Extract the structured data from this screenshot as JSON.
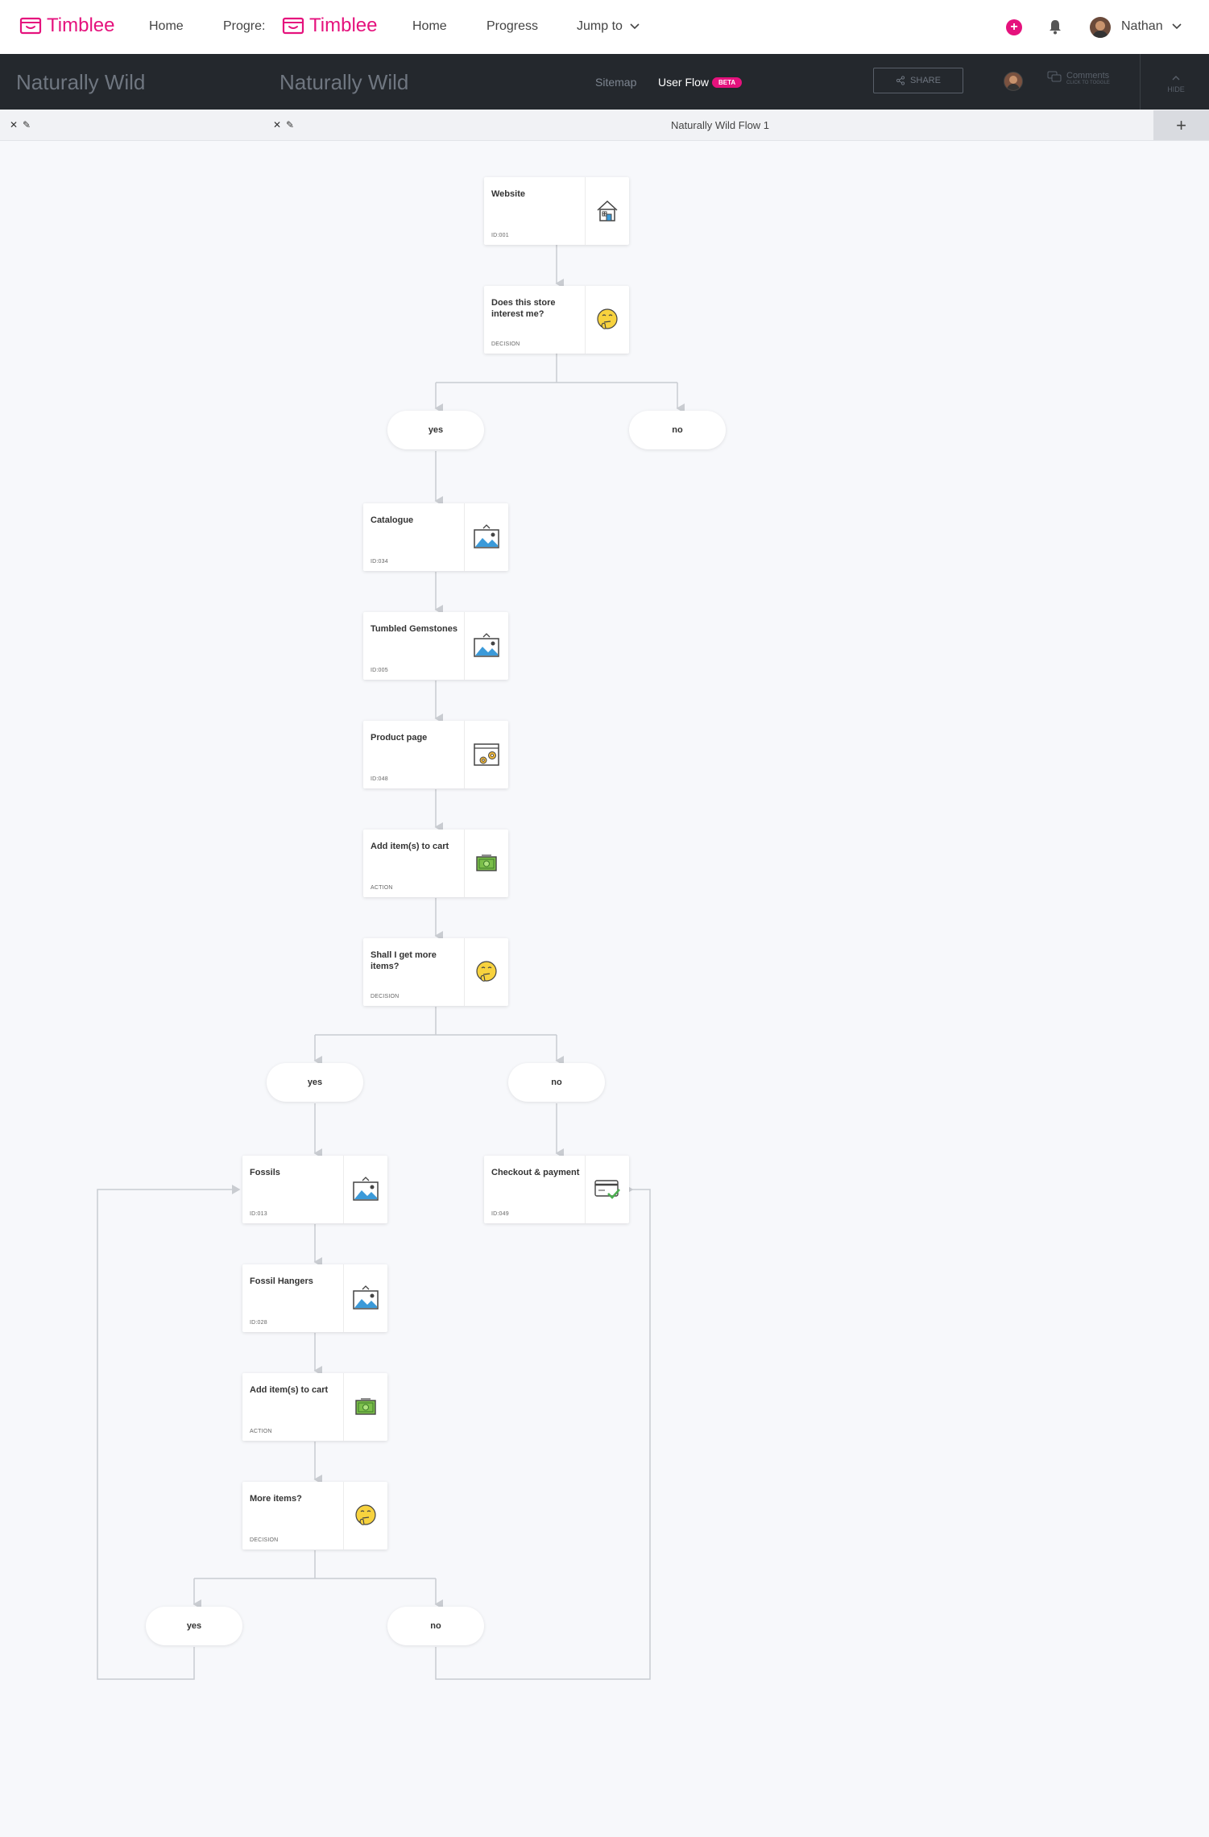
{
  "topnav": {
    "logo_text": "Timblee",
    "links": [
      "Home",
      "Progress"
    ],
    "ghost_links": [
      "Home",
      "Progre:"
    ],
    "jump_to": "Jump to",
    "user_name": "Nathan"
  },
  "project": {
    "name": "Naturally Wild",
    "tabs": [
      "Sitemap",
      "User Flow"
    ],
    "beta_badge": "BETA",
    "share_label": "SHARE",
    "comments_label": "Comments",
    "comments_sub": "CLICK TO TOGGLE",
    "hide_label": "HIDE"
  },
  "flow": {
    "title": "Naturally Wild Flow 1",
    "nodes": [
      {
        "title": "Website",
        "sub": "ID:001",
        "icon": "home-icon"
      },
      {
        "title": "Does this store interest me?",
        "sub": "DECISION",
        "icon": "thinking-face-icon"
      },
      {
        "title": "Catalogue",
        "sub": "ID:034",
        "icon": "image-icon"
      },
      {
        "title": "Tumbled Gemstones",
        "sub": "ID:005",
        "icon": "image-icon"
      },
      {
        "title": "Product page",
        "sub": "ID:048",
        "icon": "browser-settings-icon"
      },
      {
        "title": "Add item(s) to cart",
        "sub": "ACTION",
        "icon": "cash-icon"
      },
      {
        "title": "Shall I get more items?",
        "sub": "DECISION",
        "icon": "thinking-face-icon"
      },
      {
        "title": "Fossils",
        "sub": "ID:013",
        "icon": "image-icon"
      },
      {
        "title": "Checkout & payment",
        "sub": "ID:049",
        "icon": "card-check-icon"
      },
      {
        "title": "Fossil Hangers",
        "sub": "ID:028",
        "icon": "image-icon"
      },
      {
        "title": "Add item(s) to cart",
        "sub": "ACTION",
        "icon": "cash-icon"
      },
      {
        "title": "More items?",
        "sub": "DECISION",
        "icon": "thinking-face-icon"
      }
    ],
    "answers": [
      "yes",
      "no",
      "yes",
      "no",
      "yes",
      "no"
    ]
  },
  "colors": {
    "brand": "#e5127d",
    "header_bg": "#24282d",
    "canvas_bg": "#f7f8fb",
    "connector": "#c9ccd1"
  }
}
